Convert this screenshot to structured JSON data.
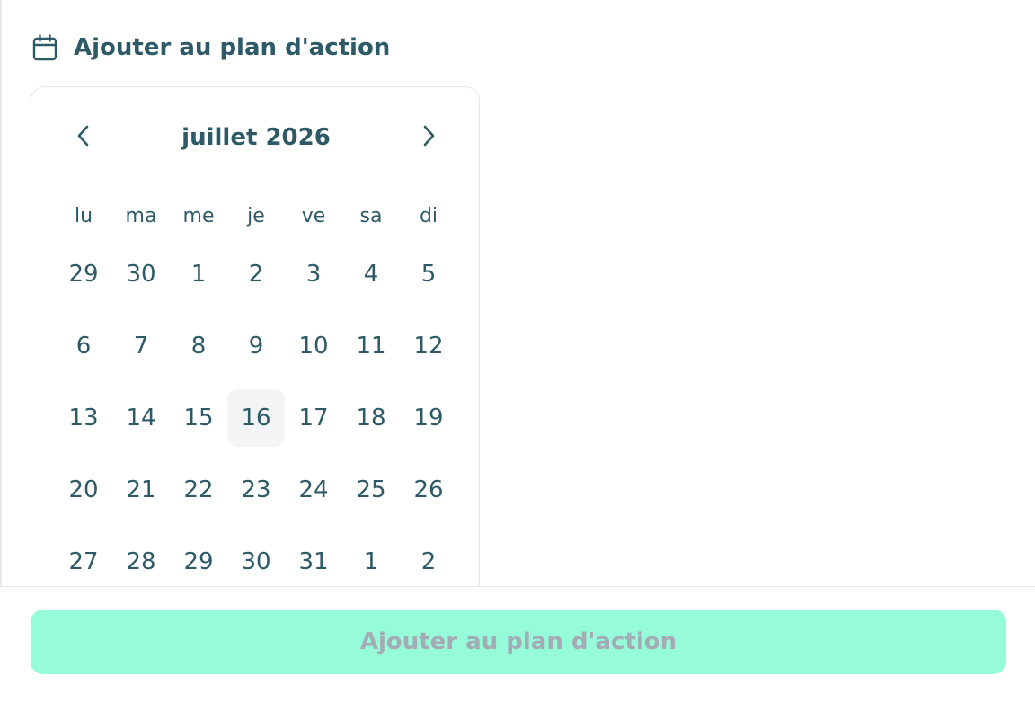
{
  "header": {
    "icon": "calendar-icon",
    "title": "Ajouter au plan d'action"
  },
  "calendar": {
    "month_label": "juillet 2026",
    "prev_icon": "chevron-left-icon",
    "next_icon": "chevron-right-icon",
    "weekdays": [
      "lu",
      "ma",
      "me",
      "je",
      "ve",
      "sa",
      "di"
    ],
    "weeks": [
      [
        "29",
        "30",
        "1",
        "2",
        "3",
        "4",
        "5"
      ],
      [
        "6",
        "7",
        "8",
        "9",
        "10",
        "11",
        "12"
      ],
      [
        "13",
        "14",
        "15",
        "16",
        "17",
        "18",
        "19"
      ],
      [
        "20",
        "21",
        "22",
        "23",
        "24",
        "25",
        "26"
      ],
      [
        "27",
        "28",
        "29",
        "30",
        "31",
        "1",
        "2"
      ]
    ],
    "today": "16"
  },
  "footer": {
    "submit_label": "Ajouter au plan d'action"
  },
  "colors": {
    "text": "#2d5a66",
    "button_bg": "#95fbd9",
    "button_text_disabled": "#a4abb5",
    "today_bg": "#f2f4f5"
  }
}
